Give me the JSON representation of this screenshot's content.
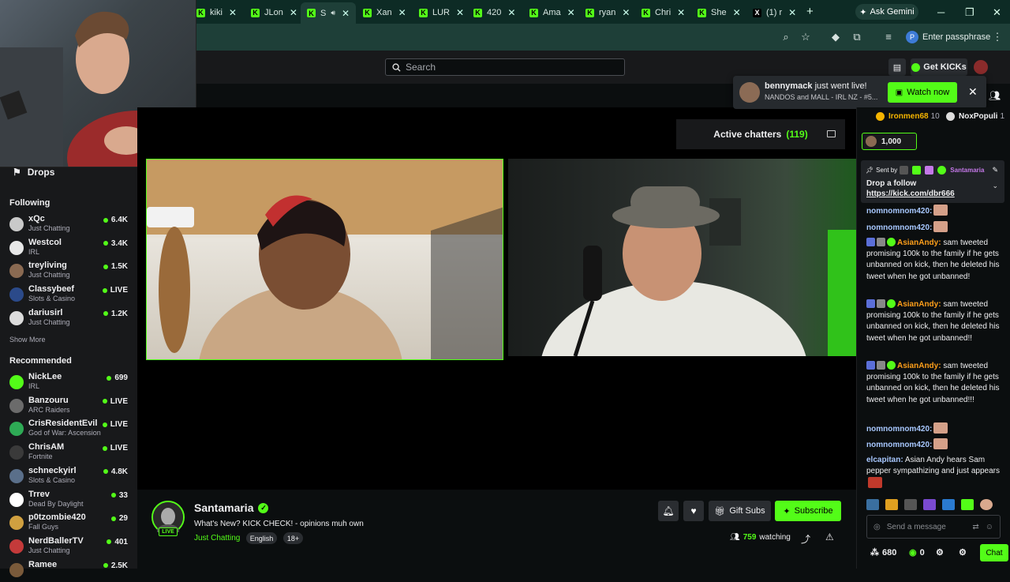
{
  "browser": {
    "tabs": [
      {
        "label": "kiki"
      },
      {
        "label": "JLon"
      },
      {
        "label": "S"
      },
      {
        "label": "Xan"
      },
      {
        "label": "LUR"
      },
      {
        "label": "420"
      },
      {
        "label": "Ama"
      },
      {
        "label": "ryan"
      },
      {
        "label": "Chri"
      },
      {
        "label": "She"
      },
      {
        "label": "(1) r"
      }
    ],
    "gemini_label": "Ask Gemini",
    "passphrase_label": "Enter passphrase",
    "passphrase_avatar": "P"
  },
  "header": {
    "search_placeholder": "Search",
    "get_kicks_label": "Get KICKs"
  },
  "notification": {
    "user": "bennymack",
    "text": " just went live!",
    "subtitle": "NANDOS and MALL - IRL NZ - #5...",
    "watch_label": "Watch now"
  },
  "sidebar": {
    "drops_label": "Drops",
    "following_title": "Following",
    "following": [
      {
        "name": "xQc",
        "category": "Just Chatting",
        "viewers": "6.4K",
        "avatar_color": "#c9c9c9"
      },
      {
        "name": "Westcol",
        "category": "IRL",
        "viewers": "3.4K",
        "avatar_color": "#e8e8e8"
      },
      {
        "name": "treyliving",
        "category": "Just Chatting",
        "viewers": "1.5K",
        "avatar_color": "#8a6a52"
      },
      {
        "name": "Classybeef",
        "category": "Slots & Casino",
        "viewers": "LIVE",
        "avatar_color": "#2b4a8a"
      },
      {
        "name": "dariusirl",
        "category": "Just Chatting",
        "viewers": "1.2K",
        "avatar_color": "#dcdcdc"
      }
    ],
    "show_more": "Show More",
    "recommended_title": "Recommended",
    "recommended": [
      {
        "name": "NickLee",
        "category": "IRL",
        "viewers": "699",
        "avatar_color": "#53fc18"
      },
      {
        "name": "Banzouru",
        "category": "ARC Raiders",
        "viewers": "LIVE",
        "avatar_color": "#6b6b6b"
      },
      {
        "name": "CrisResidentEvil",
        "category": "God of War: Ascension",
        "viewers": "LIVE",
        "avatar_color": "#2eaa55"
      },
      {
        "name": "ChrisAM",
        "category": "Fortnite",
        "viewers": "LIVE",
        "avatar_color": "#3a3a3a"
      },
      {
        "name": "schneckyirl",
        "category": "Slots & Casino",
        "viewers": "4.8K",
        "avatar_color": "#5a6f8a"
      },
      {
        "name": "Trrev",
        "category": "Dead By Daylight",
        "viewers": "33",
        "avatar_color": "#ffffff"
      },
      {
        "name": "p0tzombie420",
        "category": "Fall Guys",
        "viewers": "29",
        "avatar_color": "#d0a040"
      },
      {
        "name": "NerdBallerTV",
        "category": "Just Chatting",
        "viewers": "401",
        "avatar_color": "#c43a3a"
      },
      {
        "name": "Ramee",
        "category": "",
        "viewers": "2.5K",
        "avatar_color": "#7a5a3a"
      }
    ]
  },
  "active_chatters": {
    "label": "Active chatters",
    "count": "(119)"
  },
  "stream": {
    "streamer": "Santamaria",
    "title": "What's New? KICK CHECK! - opinions muh own",
    "category": "Just Chatting",
    "tags": [
      "English",
      "18+"
    ],
    "live_badge": "LIVE",
    "gift_subs_label": "Gift Subs",
    "subscribe_label": "Subscribe",
    "watching_count": "759",
    "watching_label": "watching"
  },
  "chat": {
    "top_gifters": [
      {
        "name": "Ironmen68",
        "count": "10"
      },
      {
        "name": "NoxPopuli",
        "count": "1"
      }
    ],
    "gift_amount": "1,000",
    "pinned": {
      "sent_by": "Sent by",
      "sender": "Santamaria",
      "message": "Drop a follow",
      "link": "https://kick.com/dbr666"
    },
    "messages": [
      {
        "user": "nomnomnom420:",
        "text": "",
        "color": "#a8c8ff",
        "emote": true
      },
      {
        "user": "nomnomnom420:",
        "text": "",
        "color": "#a8c8ff",
        "emote": true
      },
      {
        "user": "AsianAndy:",
        "text": " sam tweeted promising 100k to the family if he gets unbanned on kick, then he deleted his tweet when he got unbanned!",
        "color": "#ff9f1a",
        "emote": false
      },
      {
        "user": "AsianAndy:",
        "text": " sam tweeted promising 100k to the family if he gets unbanned on kick, then he deleted his tweet when he got unbanned!!",
        "color": "#ff9f1a",
        "emote": false
      },
      {
        "user": "AsianAndy:",
        "text": " sam tweeted promising 100k to the family if he gets unbanned on kick, then he deleted his tweet when he got unbanned!!!",
        "color": "#ff9f1a",
        "emote": false
      },
      {
        "user": "nomnomnom420:",
        "text": "",
        "color": "#a8c8ff",
        "emote": true
      },
      {
        "user": "nomnomnom420:",
        "text": "",
        "color": "#a8c8ff",
        "emote": true
      },
      {
        "user": "elcapitan:",
        "text": " Asian Andy hears Sam pepper sympathizing and just appears",
        "color": "#a8c8ff",
        "emote": true
      }
    ],
    "input_placeholder": "Send a message",
    "kicks_count": "680",
    "coin_count": "0",
    "chat_button": "Chat"
  },
  "colors": {
    "accent": "#53fc18",
    "background": "#0b0e0f",
    "panel": "#18191b"
  }
}
